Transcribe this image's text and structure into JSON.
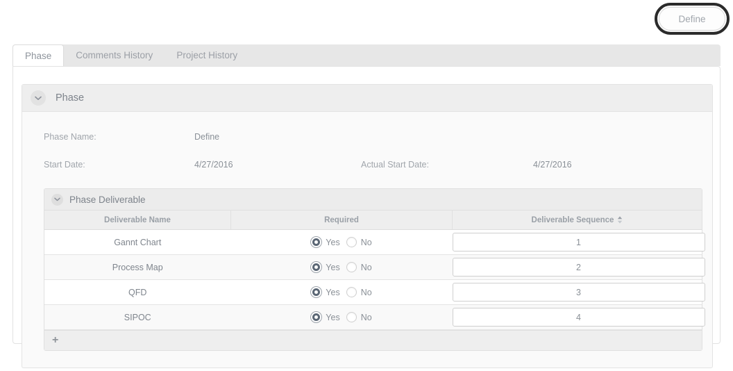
{
  "annotation": {
    "define_button_label": "Define",
    "ring_color": "#2b2b2b"
  },
  "tabs": [
    {
      "label": "Phase",
      "active": true
    },
    {
      "label": "Comments History",
      "active": false
    },
    {
      "label": "Project History",
      "active": false
    }
  ],
  "phase_section": {
    "title": "Phase",
    "collapse_icon": "chevron-down-icon",
    "fields": [
      {
        "label": "Phase Name:",
        "value": "Define"
      },
      {
        "label": "Start Date:",
        "value": "4/27/2016"
      },
      {
        "label": "Actual Start Date:",
        "value": "4/27/2016"
      }
    ]
  },
  "deliverable_section": {
    "title": "Phase Deliverable",
    "collapse_icon": "chevron-down-icon",
    "columns": [
      {
        "label": "Deliverable Name",
        "sortable": false
      },
      {
        "label": "Required",
        "sortable": false
      },
      {
        "label": "Deliverable Sequence",
        "sortable": true,
        "sort_icon": "sort-arrows-icon"
      }
    ],
    "radio_options": {
      "yes": "Yes",
      "no": "No"
    },
    "rows": [
      {
        "name": "Gannt Chart",
        "required": "Yes",
        "sequence": "1"
      },
      {
        "name": "Process Map",
        "required": "Yes",
        "sequence": "2"
      },
      {
        "name": "QFD",
        "required": "Yes",
        "sequence": "3"
      },
      {
        "name": "SIPOC",
        "required": "Yes",
        "sequence": "4"
      }
    ],
    "add_row_label": "+"
  },
  "colors": {
    "radio_selected": "#5b6775",
    "header_bg": "#eeeeee",
    "text_muted": "#9aa0a7"
  }
}
